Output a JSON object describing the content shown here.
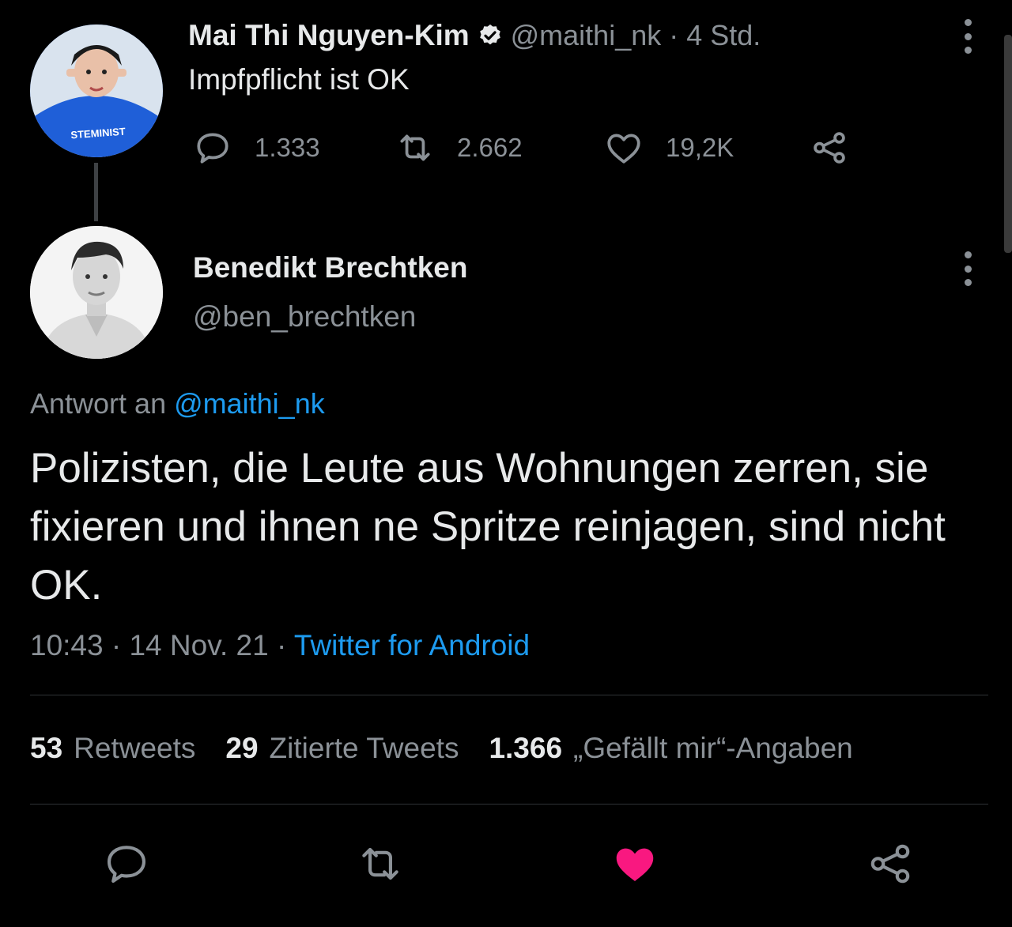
{
  "tweet1": {
    "display_name": "Mai Thi Nguyen-Kim",
    "handle": "@maithi_nk",
    "time": "· 4 Std.",
    "text": "Impfpflicht ist OK",
    "avatar_text": "STEMINIST",
    "replies": "1.333",
    "retweets": "2.662",
    "likes": "19,2K"
  },
  "tweet2": {
    "display_name": "Benedikt Brechtken",
    "handle": "@ben_brechtken",
    "reply_prefix": "Antwort an",
    "reply_to": "@maithi_nk",
    "text": "Polizisten, die Leute aus Wohnungen zerren, sie fixieren und ihnen ne Spritze reinjagen, sind nicht OK.",
    "time": "10:43 · 14 Nov. 21 ·",
    "source": "Twitter for Android"
  },
  "stats": {
    "retweets_count": "53",
    "retweets_label": "Retweets",
    "quotes_count": "29",
    "quotes_label": "Zitierte Tweets",
    "likes_count": "1.366",
    "likes_label": "„Gefällt mir“-Angaben"
  },
  "colors": {
    "background": "#000000",
    "text": "#e7e9ea",
    "muted": "#8b9197",
    "link": "#1d9bf0",
    "like_active": "#f91880"
  },
  "icons": {
    "reply": "reply-icon",
    "retweet": "retweet-icon",
    "like": "heart-icon",
    "share": "share-icon",
    "verified": "verified-badge-icon",
    "more": "more-vertical-icon"
  }
}
